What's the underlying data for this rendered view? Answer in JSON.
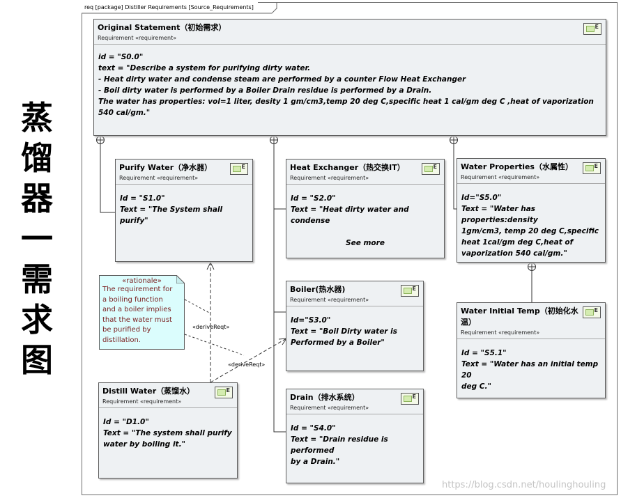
{
  "side_title": [
    "蒸",
    "馏",
    "器",
    "一",
    "需",
    "求",
    "图"
  ],
  "frame_label": "req [package] Distiller Requirements [Source_Requirements]",
  "requirement_icon_letter": "E",
  "stereotype": "Requirement «requirement»",
  "requirements": {
    "original": {
      "name": "Original Statement（初始需求）",
      "lines": [
        "id = \"S0.0\"",
        "text = \"Describe a system for purifying dirty water.",
        "- Heat dirty water and condense steam are performed by a counter Flow Heat Exchanger",
        "- Boil dirty water is performed by a Boiler Drain residue is performed by a Drain.",
        "The water has properties: vol=1 liter, desity 1 gm/cm3,temp 20 deg C,specific heat 1 cal/gm deg C ,heat of vaporization 540 cal/gm.\""
      ]
    },
    "purify": {
      "name": "Purify Water（净水器）",
      "lines": [
        "Id = \"S1.0\"",
        "Text = \"The System shall purify\""
      ]
    },
    "heat_exchanger": {
      "name": "Heat Exchanger（热交换IT）",
      "lines": [
        "Id = \"S2.0\"",
        "Text = \"Heat dirty water and condense"
      ],
      "see_more": "See more"
    },
    "water_props": {
      "name": "Water Properties（水属性）",
      "lines": [
        "Id=\"S5.0\"",
        "Text = \"Water has properties:density",
        "1gm/cm3, temp 20 deg C,specific",
        "heat 1cal/gm deg C,heat of",
        "vaporization 540 cal/gm.\""
      ]
    },
    "boiler": {
      "name": "Boiler(热水器)",
      "lines": [
        "Id=\"S3.0\"",
        "Text = \"Boil Dirty water is",
        "Performed by a Boiler\""
      ]
    },
    "water_temp": {
      "name": "Water Initial Temp（初始化水",
      "name2": "温）",
      "lines": [
        "Id = \"S5.1\"",
        "Text = \"Water has an initial temp 20",
        "deg C.\""
      ]
    },
    "distill": {
      "name": "Distill Water（蒸馏水）",
      "lines": [
        "Id = \"D1.0\"",
        "Text = \"The system shall purify",
        "water by boiling it.\""
      ]
    },
    "drain": {
      "name": "Drain（排水系统）",
      "lines": [
        "Id = \"S4.0\"",
        "Text = \"Drain residue is performed",
        "by a Drain.\""
      ]
    }
  },
  "rationale": {
    "stereotype": "«rationale»",
    "lines": [
      "The requirement for",
      "a boiling function",
      "and a boiler implies",
      "that the water must",
      "be purified by",
      "distillation."
    ]
  },
  "connector_labels": [
    "«deriveReqt»",
    "«deriveReqt»"
  ],
  "watermark": "https://blog.csdn.net/houlinghouling",
  "colors": {
    "box_fill": "#eef1f3",
    "note_fill": "#dbfdfd",
    "note_text": "#7a1f1f"
  }
}
